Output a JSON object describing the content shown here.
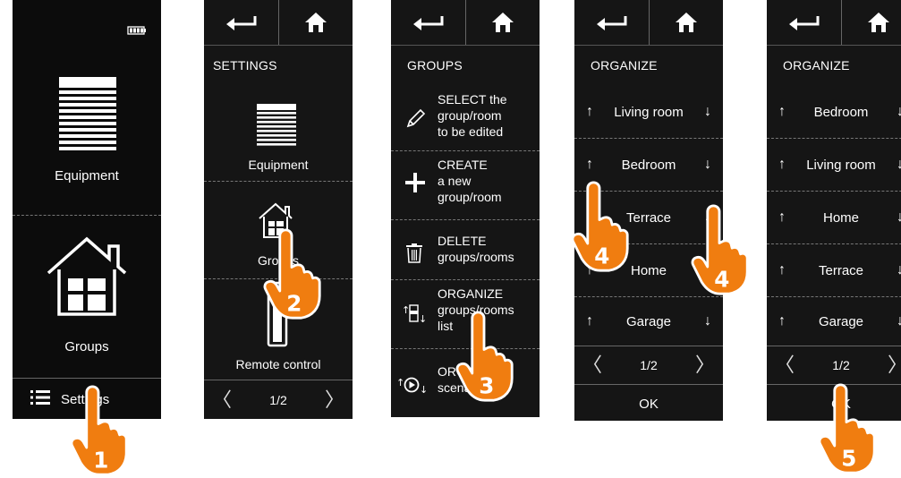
{
  "screen1": {
    "equipment_label": "Equipment",
    "groups_label": "Groups",
    "settings_label": "Settings"
  },
  "screen2": {
    "title": "SETTINGS",
    "equipment_label": "Equipment",
    "groups_label": "Groups",
    "remote_label": "Remote control",
    "page": "1/2"
  },
  "screen3": {
    "title": "GROUPS",
    "items": [
      {
        "line1": "SELECT the",
        "line2": "group/room",
        "line3": "to be edited",
        "icon": "pencil-icon"
      },
      {
        "line1": "CREATE",
        "line2": "a new",
        "line3": "group/room",
        "icon": "plus-icon"
      },
      {
        "line1": "DELETE",
        "line2": "groups/rooms",
        "line3": "",
        "icon": "trash-icon"
      },
      {
        "line1": "ORGANIZE",
        "line2": "groups/rooms",
        "line3": "list",
        "icon": "sort-icon"
      },
      {
        "line1": "ORGANIZE",
        "line2": "scenarii list",
        "line3": "",
        "icon": "scenario-sort-icon"
      }
    ]
  },
  "screen4": {
    "title": "ORGANIZE",
    "rows": [
      "Living room",
      "Bedroom",
      "Terrace",
      "Home",
      "Garage"
    ],
    "page": "1/2",
    "ok": "OK"
  },
  "screen5": {
    "title": "ORGANIZE",
    "rows": [
      "Bedroom",
      "Living room",
      "Home",
      "Terrace",
      "Garage"
    ],
    "page": "1/2",
    "ok": "OK"
  },
  "steps": [
    "1",
    "2",
    "3",
    "4",
    "4",
    "5"
  ],
  "colors": {
    "hand": "#f07d10",
    "screen": "#151515"
  }
}
